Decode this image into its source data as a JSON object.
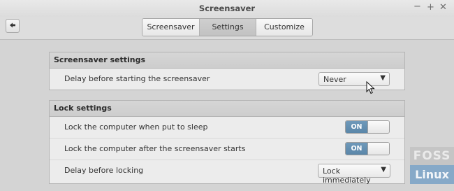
{
  "window": {
    "title": "Screensaver",
    "controls": {
      "minimize": "−",
      "maximize": "+",
      "close": "✕"
    }
  },
  "toolbar": {
    "back_icon": "back-arrow-icon",
    "tabs": [
      {
        "label": "Screensaver",
        "selected": false
      },
      {
        "label": "Settings",
        "selected": true
      },
      {
        "label": "Customize",
        "selected": false
      }
    ]
  },
  "sections": {
    "screensaver": {
      "heading": "Screensaver settings",
      "rows": [
        {
          "label": "Delay before starting the screensaver",
          "value": "Never"
        }
      ]
    },
    "lock": {
      "heading": "Lock settings",
      "rows": [
        {
          "label": "Lock the computer when put to sleep",
          "toggle": "ON"
        },
        {
          "label": "Lock the computer after the screensaver starts",
          "toggle": "ON"
        },
        {
          "label": "Delay before locking",
          "value": "Lock immediately"
        }
      ]
    }
  },
  "watermark": {
    "top": "FOSS",
    "bottom": "Linux"
  },
  "colors": {
    "toggle_on": "#5f8bad",
    "watermark_blue": "#86a9c8"
  }
}
